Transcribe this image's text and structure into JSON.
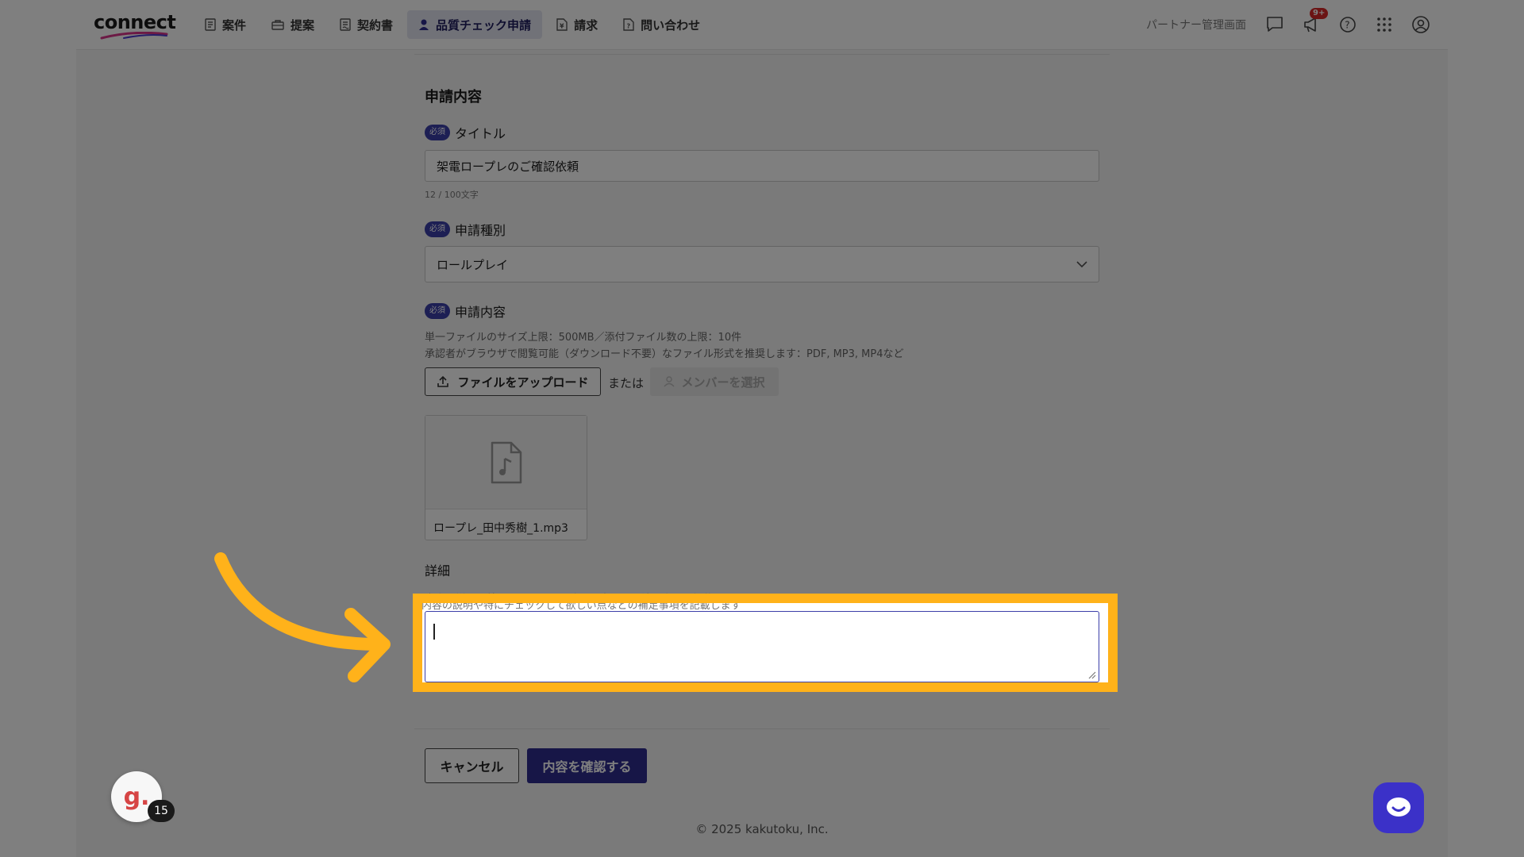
{
  "header": {
    "logo": "connect",
    "nav": [
      {
        "label": "案件",
        "icon": "document-list-icon",
        "active": false
      },
      {
        "label": "提案",
        "icon": "briefcase-icon",
        "active": false
      },
      {
        "label": "契約書",
        "icon": "contract-icon",
        "active": false
      },
      {
        "label": "品質チェック申請",
        "icon": "user-check-icon",
        "active": true
      },
      {
        "label": "請求",
        "icon": "invoice-icon",
        "active": false
      },
      {
        "label": "問い合わせ",
        "icon": "inquiry-icon",
        "active": false
      }
    ],
    "admin_link": "パートナー管理画面",
    "notification_badge": "9+"
  },
  "form": {
    "section_title": "申請内容",
    "required_label": "必須",
    "title_field": {
      "label": "タイトル",
      "value": "架電ロープレのご確認依頼",
      "counter": "12 / 100文字"
    },
    "type_field": {
      "label": "申請種別",
      "value": "ロールプレイ"
    },
    "content_field": {
      "label": "申請内容",
      "help_1": "単一ファイルのサイズ上限：500MB／添付ファイル数の上限：10件",
      "help_2": "承認者がブラウザで閲覧可能（ダウンロード不要）なファイル形式を推奨します：PDF, MP3, MP4など",
      "upload_button": "ファイルをアップロード",
      "or_text": "または",
      "member_button": "メンバーを選択",
      "file_name": "ロープレ_田中秀樹_1.mp3"
    },
    "detail_field": {
      "label": "詳細",
      "help": "内容の説明や特にチェックして欲しい点などの補足事項を記載します",
      "value": ""
    },
    "cancel_button": "キャンセル",
    "confirm_button": "内容を確認する"
  },
  "footer": "© 2025 kakutoku, Inc.",
  "floater": {
    "logo": "g.",
    "count": "15"
  },
  "colors": {
    "accent": "#2f2c8f",
    "highlight": "#ffb21a",
    "badge": "#d72828"
  }
}
